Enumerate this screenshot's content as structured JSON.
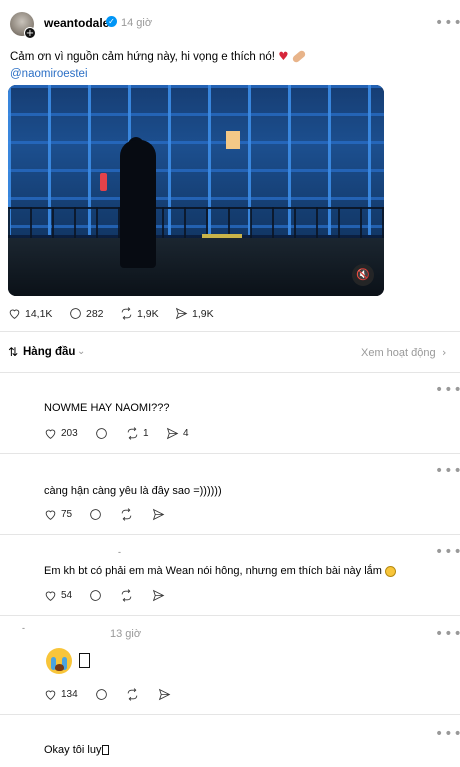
{
  "post": {
    "username": "weantodale",
    "time": "14 giờ",
    "caption": "Cảm ơn vì nguồn cảm hứng này, hi vọng e thích nó!",
    "mention": "@naomiroestei",
    "more_label": "•••",
    "stats": {
      "likes": "14,1K",
      "comments": "282",
      "reposts": "1,9K",
      "shares": "1,9K"
    }
  },
  "sort": {
    "label": "Hàng đầu",
    "activity_link": "Xem hoạt động"
  },
  "replies": [
    {
      "text": "NOWME HAY NAOMI???",
      "likes": "203",
      "reposts": "1",
      "shares": "4"
    },
    {
      "text": "càng hận càng yêu là đây sao =))))))",
      "likes": "75"
    },
    {
      "text": "Em kh bt có phải em mà Wean nói hông, nhưng em thích bài này lắm",
      "likes": "54"
    },
    {
      "time": "13 giờ",
      "likes": "134"
    },
    {
      "text": "Okay tôi luy"
    }
  ],
  "icons": {
    "heart": "heart-icon",
    "comment": "comment-icon",
    "repost": "repost-icon",
    "share": "share-icon",
    "mute": "speaker-muted-icon"
  },
  "colors": {
    "mention": "#2b6fc5",
    "verified": "#0095f6",
    "muted_text": "#999999",
    "divider": "#e5e5e5"
  }
}
